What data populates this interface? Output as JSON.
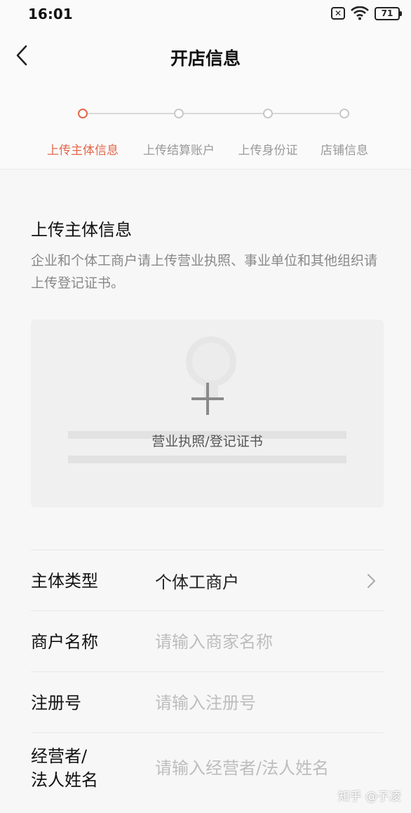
{
  "status_bar": {
    "time": "16:01",
    "battery": "71",
    "sim": "✕"
  },
  "nav": {
    "title": "开店信息"
  },
  "stepper": {
    "steps": [
      {
        "label": "上传主体信息",
        "active": true
      },
      {
        "label": "上传结算账户",
        "active": false
      },
      {
        "label": "上传身份证",
        "active": false
      },
      {
        "label": "店铺信息",
        "active": false
      }
    ]
  },
  "section": {
    "title": "上传主体信息",
    "description": "企业和个体工商户请上传营业执照、事业单位和其他组织请上传登记证书。"
  },
  "upload": {
    "label": "营业执照/登记证书"
  },
  "form": {
    "subject_type": {
      "label": "主体类型",
      "value": "个体工商户"
    },
    "merchant_name": {
      "label": "商户名称",
      "placeholder": "请输入商家名称"
    },
    "registration_no": {
      "label": "注册号",
      "placeholder": "请输入注册号"
    },
    "operator_name": {
      "label_line1": "经营者/",
      "label_line2": "法人姓名",
      "placeholder": "请输入经营者/法人姓名"
    }
  },
  "watermark": "知乎 @子凌",
  "colors": {
    "accent": "#e3674b",
    "placeholder": "#bdbdbd",
    "divider": "#e8e8e8"
  }
}
